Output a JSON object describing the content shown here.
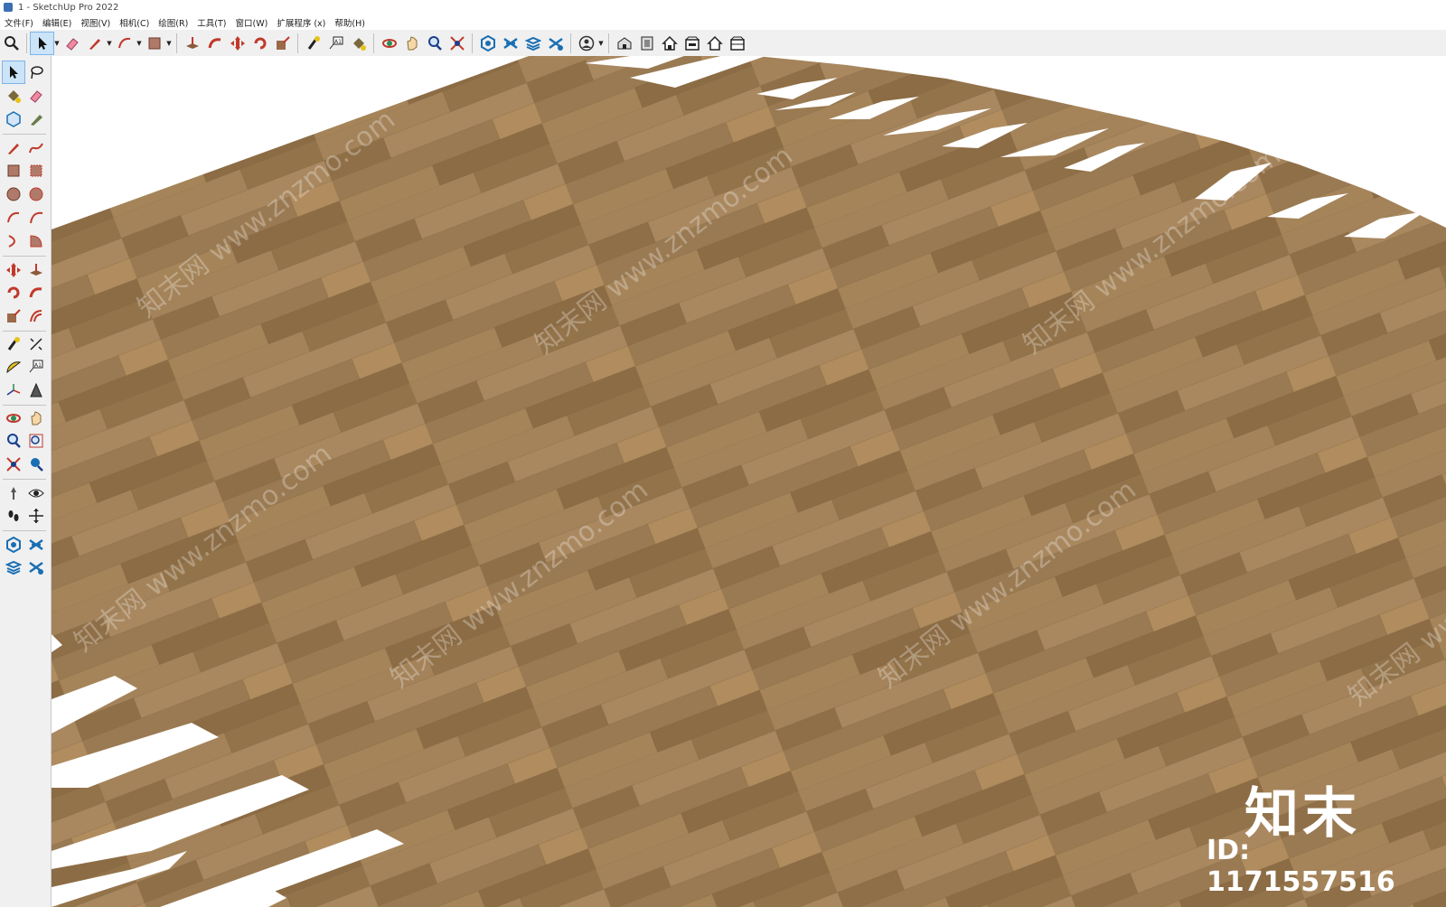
{
  "window": {
    "title": "1 - SketchUp Pro 2022"
  },
  "menu": {
    "items": [
      "文件(F)",
      "编辑(E)",
      "视图(V)",
      "相机(C)",
      "绘图(R)",
      "工具(T)",
      "窗口(W)",
      "扩展程序 (x)",
      "帮助(H)"
    ]
  },
  "toolbar": {
    "tools": [
      "zoom-icon",
      "select-icon",
      "eraser-icon",
      "pencil-icon",
      "arc-icon",
      "rectangle-icon",
      "push-pull-icon",
      "follow-me-icon",
      "move-icon",
      "rotate-icon",
      "scale-icon",
      "tape-measure-icon",
      "text-icon",
      "paint-bucket-icon",
      "orbit-icon",
      "pan-icon",
      "zoom-window-icon",
      "zoom-extents-icon",
      "warehouse-icon",
      "extension-warehouse-icon",
      "layout-icon",
      "send-icon",
      "account-icon",
      "iso-view-icon",
      "top-view-icon",
      "front-view-icon",
      "right-view-icon",
      "back-view-icon",
      "left-view-icon"
    ]
  },
  "colors": {
    "wood": "#9b7a4f",
    "wood_light": "#b08c5e",
    "wood_dark": "#866644",
    "background": "#ffffff",
    "toolbar": "#f0f0f0"
  },
  "watermark": {
    "text": "知末网 www.znzmo.com",
    "logo": "知末",
    "id": "ID: 1171557516"
  }
}
